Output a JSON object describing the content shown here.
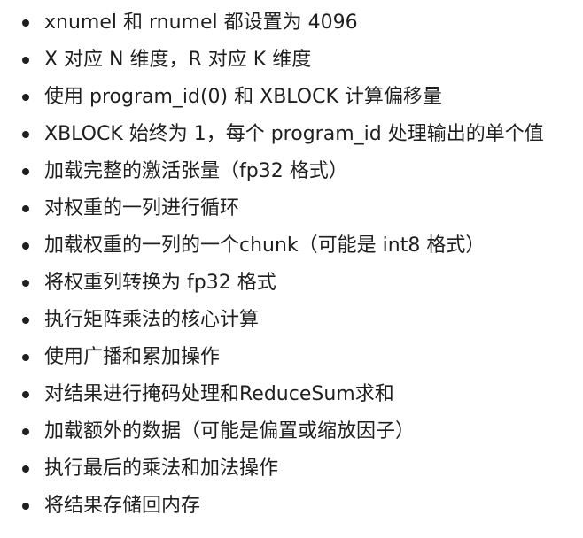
{
  "items": [
    "xnumel 和 rnumel 都设置为 4096",
    "X 对应 N 维度，R 对应 K 维度",
    "使用 program_id(0) 和 XBLOCK 计算偏移量",
    "XBLOCK 始终为 1，每个 program_id 处理输出的单个值",
    "加载完整的激活张量（fp32 格式）",
    "对权重的一列进行循环",
    "加载权重的一列的一个chunk（可能是 int8 格式）",
    "将权重列转换为 fp32 格式",
    "执行矩阵乘法的核心计算",
    "使用广播和累加操作",
    "对结果进行掩码处理和ReduceSum求和",
    "加载额外的数据（可能是偏置或缩放因子）",
    "执行最后的乘法和加法操作",
    "将结果存储回内存"
  ]
}
